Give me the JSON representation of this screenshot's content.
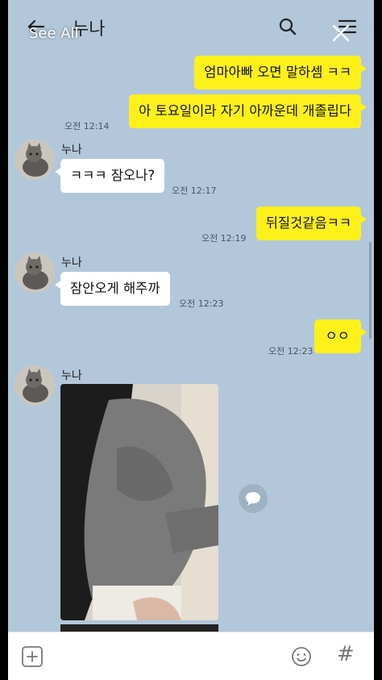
{
  "header": {
    "title": "누나",
    "see_all": "See All"
  },
  "messages": [
    {
      "type": "out",
      "text": "엄마아빠 오면 말하셈 ㅋㅋ"
    },
    {
      "type": "out",
      "text": "아 토요일이라 자기 아까운데 개졸립다",
      "time": "오전 12:14"
    },
    {
      "type": "in",
      "sender": "누나",
      "text": "ㅋㅋㅋ 잠오나?",
      "time": "오전 12:17"
    },
    {
      "type": "out",
      "text": "뒤질것같음ㅋㅋ",
      "time": "오전 12:19"
    },
    {
      "type": "in",
      "sender": "누나",
      "text": "잠안오게 해주까",
      "time": "오전 12:23"
    },
    {
      "type": "out",
      "text": "ㅇㅇ",
      "time": "오전 12:23"
    },
    {
      "type": "in",
      "sender": "누나",
      "kind": "photo"
    }
  ],
  "input_bar": {
    "hash_label": "#"
  },
  "colors": {
    "chat_background": "#b2c7da",
    "outgoing_bubble": "#fef01b",
    "incoming_bubble": "#ffffff"
  }
}
